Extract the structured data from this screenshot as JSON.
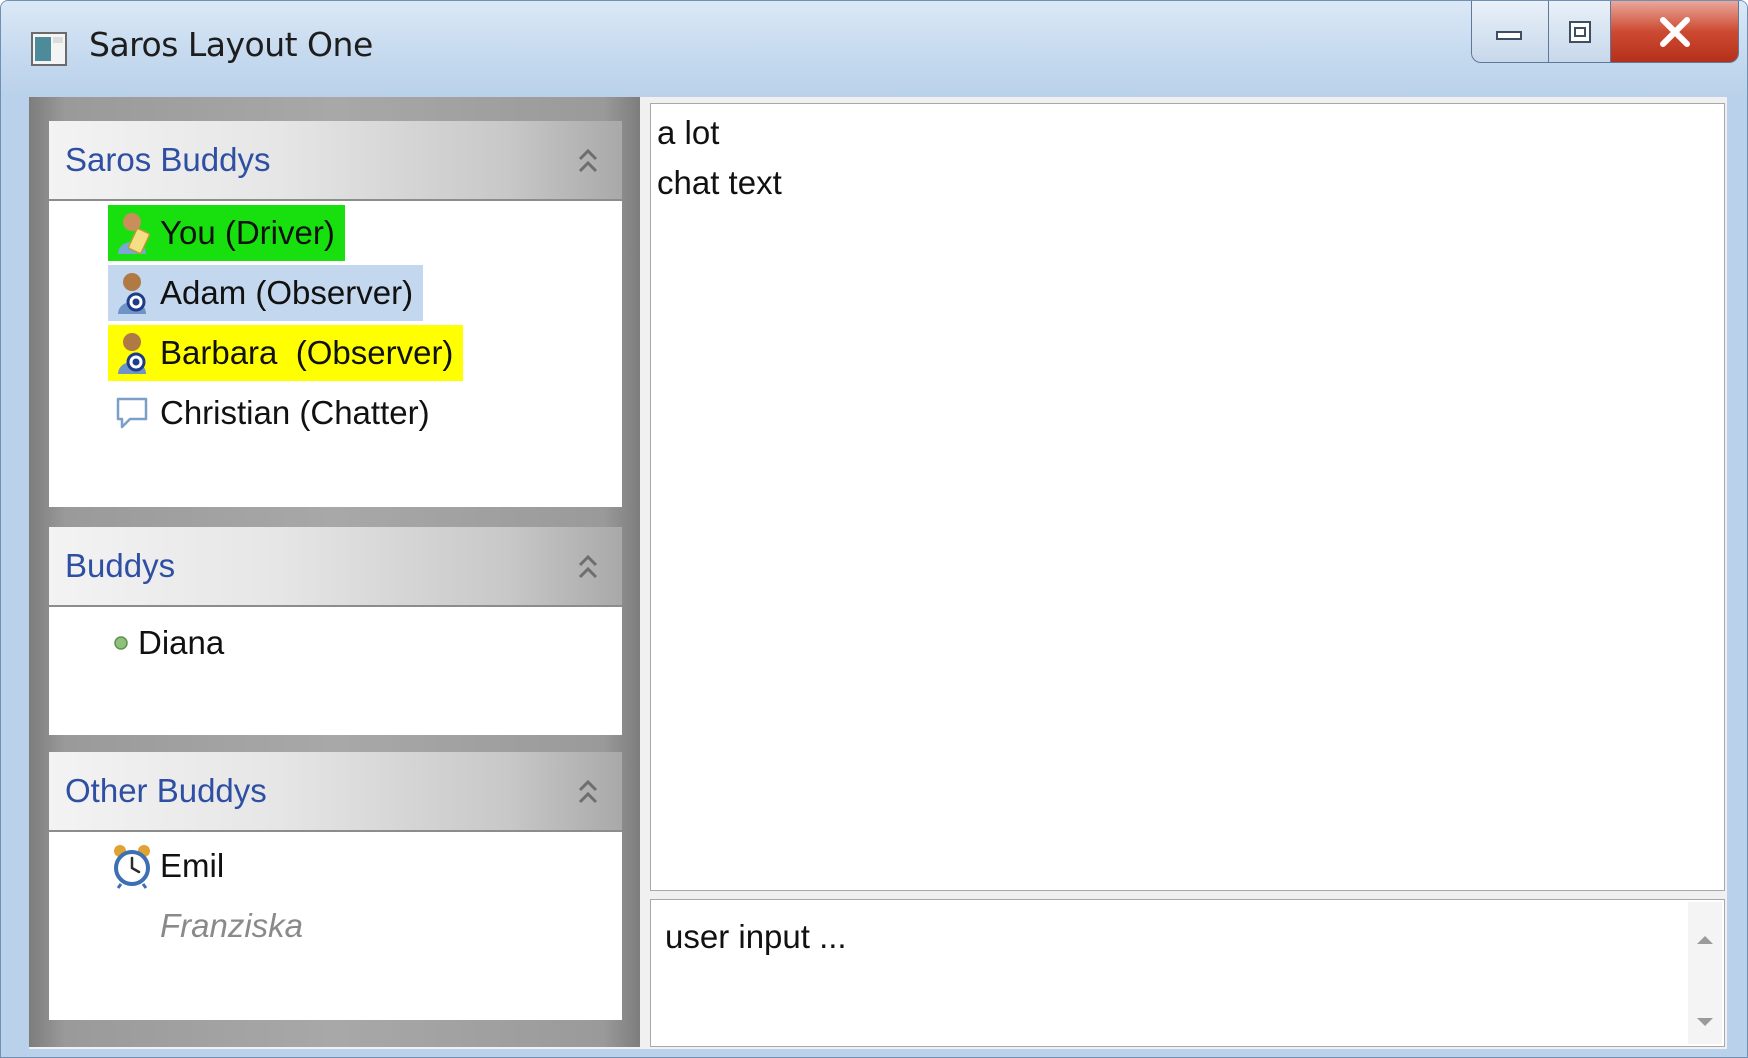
{
  "window": {
    "title": "Saros Layout One"
  },
  "sections": {
    "saros_buddys": {
      "title": "Saros Buddys",
      "items": [
        {
          "label": "You (Driver)",
          "icon": "driver-user-icon",
          "highlight": "#17e00e"
        },
        {
          "label": "Adam (Observer)",
          "icon": "observer-user-icon",
          "highlight": "#c3d7ee"
        },
        {
          "label": "Barbara  (Observer)",
          "icon": "observer-user-icon",
          "highlight": "#ffff00"
        },
        {
          "label": "Christian (Chatter)",
          "icon": "chat-bubble-icon",
          "highlight": ""
        }
      ]
    },
    "buddys": {
      "title": "Buddys",
      "items": [
        {
          "label": "Diana",
          "icon": "online-dot-icon"
        }
      ]
    },
    "other_buddys": {
      "title": "Other Buddys",
      "items": [
        {
          "label": "Emil",
          "icon": "alarm-clock-icon"
        },
        {
          "label": "Franziska",
          "icon": "",
          "style": "italic-gray"
        }
      ]
    }
  },
  "chat": {
    "lines": [
      "a lot",
      "chat text"
    ]
  },
  "input": {
    "text": "user input ..."
  },
  "colors": {
    "section_title": "#2f4fa3",
    "title_bar": "#c6daef",
    "close_button": "#cd4a32"
  }
}
